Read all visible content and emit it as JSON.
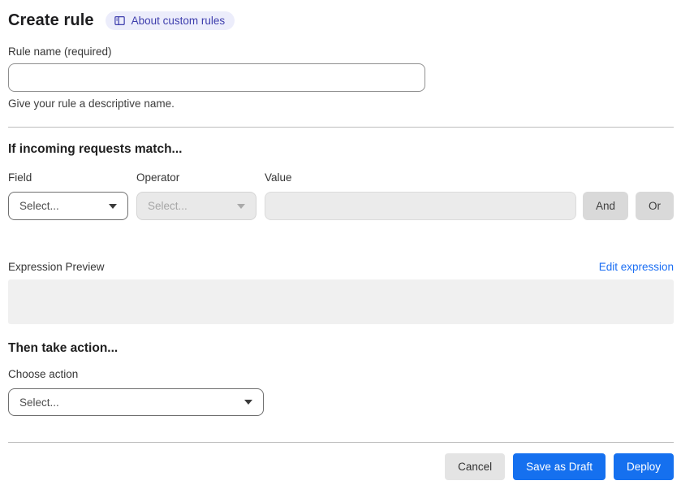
{
  "page": {
    "title": "Create rule",
    "about_badge": "About custom rules"
  },
  "rule_name": {
    "label": "Rule name (required)",
    "value": "",
    "helper": "Give your rule a descriptive name."
  },
  "match_section": {
    "heading": "If incoming requests match...",
    "field": {
      "label": "Field",
      "selected": "Select..."
    },
    "operator": {
      "label": "Operator",
      "selected": "Select..."
    },
    "value": {
      "label": "Value",
      "value": ""
    },
    "and_button": "And",
    "or_button": "Or"
  },
  "expression": {
    "label": "Expression Preview",
    "edit_link": "Edit expression",
    "preview": ""
  },
  "action_section": {
    "heading": "Then take action...",
    "choose_label": "Choose action",
    "selected": "Select..."
  },
  "footer": {
    "cancel": "Cancel",
    "save_draft": "Save as Draft",
    "deploy": "Deploy"
  },
  "colors": {
    "primary_blue": "#1570ef",
    "link_blue": "#1b6ef3",
    "badge_bg": "#ecedfb",
    "badge_text": "#3e3ead",
    "disabled_bg": "#e9e9e9",
    "gray_button_bg": "#d9d9d9",
    "preview_box_bg": "#f0f0f0"
  }
}
